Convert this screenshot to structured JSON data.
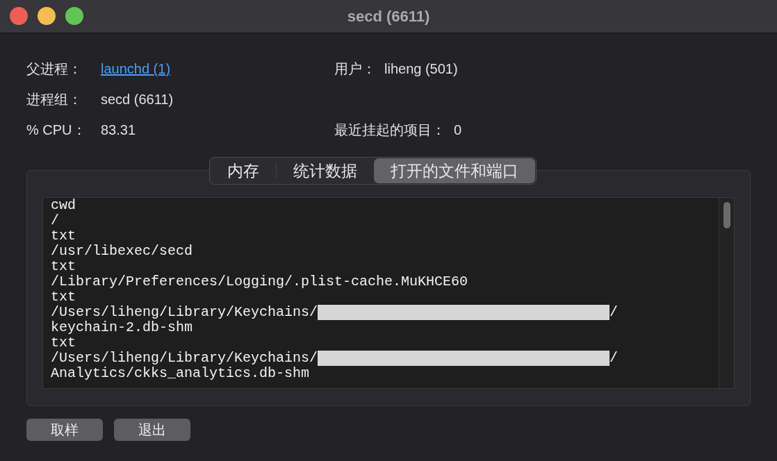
{
  "window": {
    "title": "secd (6611)"
  },
  "info": [
    {
      "label": "父进程：",
      "value": "launchd (1)",
      "kind": "link"
    },
    {
      "label": "用户：",
      "value": "liheng (501)",
      "kind": "text"
    },
    {
      "label": "进程组：",
      "value": "secd (6611)",
      "kind": "text"
    },
    {
      "label": "% CPU：",
      "value": "83.31",
      "kind": "text"
    },
    {
      "label": "最近挂起的项目：",
      "value": "0",
      "kind": "text"
    }
  ],
  "tabs": [
    {
      "label": "内存",
      "selected": false
    },
    {
      "label": "统计数据",
      "selected": false
    },
    {
      "label": "打开的文件和端口",
      "selected": true
    }
  ],
  "lines": [
    {
      "kind": "plain",
      "text": "cwd"
    },
    {
      "kind": "plain",
      "text": "/"
    },
    {
      "kind": "plain",
      "text": "txt"
    },
    {
      "kind": "plain",
      "text": "/usr/libexec/secd"
    },
    {
      "kind": "plain",
      "text": "txt"
    },
    {
      "kind": "plain",
      "text": "/Library/Preferences/Logging/.plist-cache.MuKHCE60"
    },
    {
      "kind": "plain",
      "text": "txt"
    },
    {
      "kind": "redacted",
      "before": "/Users/liheng/Library/Keychains/",
      "after": "/"
    },
    {
      "kind": "plain",
      "text": "keychain-2.db-shm"
    },
    {
      "kind": "plain",
      "text": "txt"
    },
    {
      "kind": "redacted",
      "before": "/Users/liheng/Library/Keychains/",
      "after": "/"
    },
    {
      "kind": "plain",
      "text": "Analytics/ckks_analytics.db-shm"
    }
  ],
  "buttons": [
    "取样",
    "退出"
  ]
}
